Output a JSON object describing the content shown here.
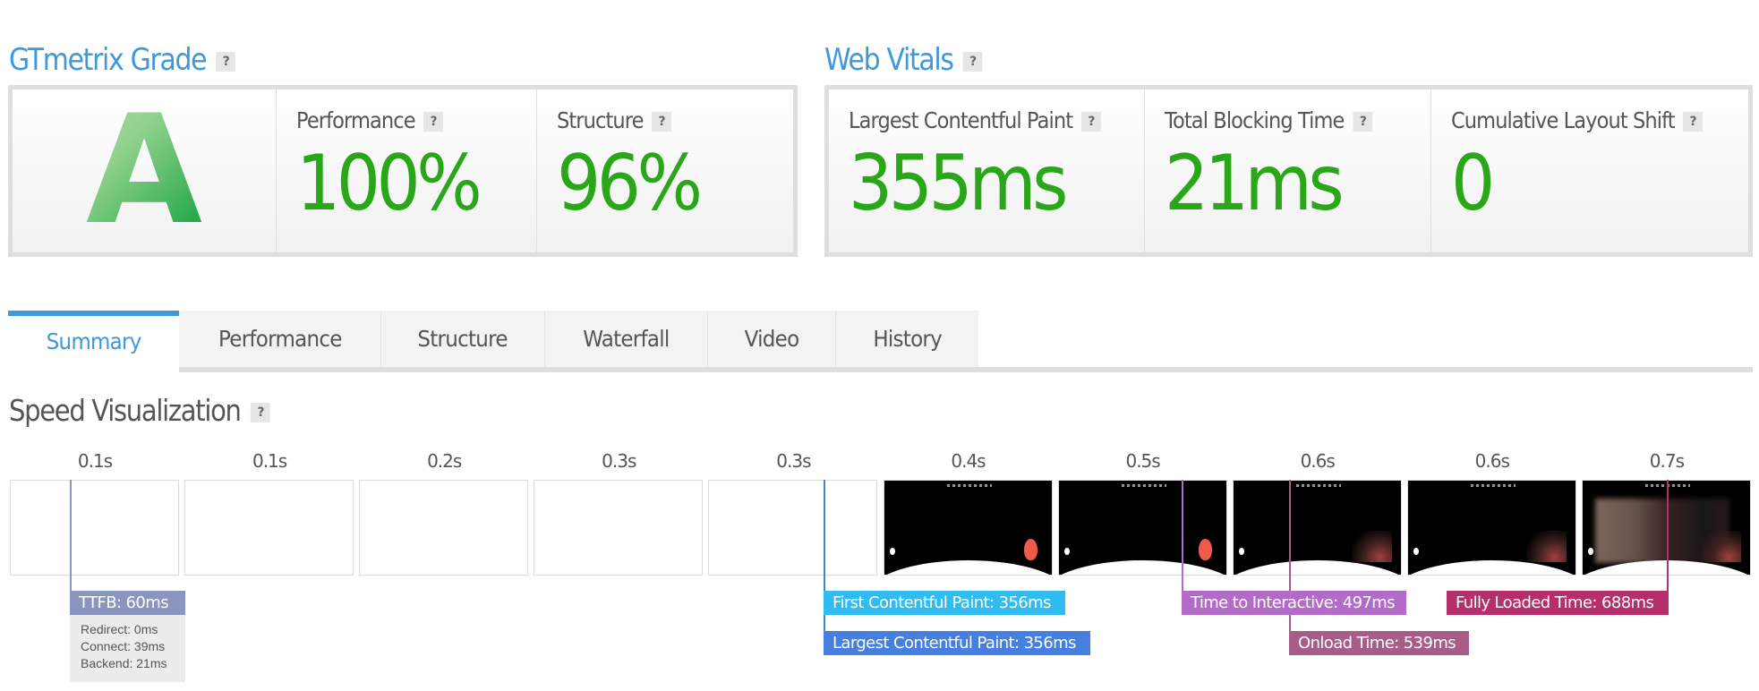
{
  "grade_section": {
    "title": "GTmetrix Grade",
    "help": "?",
    "grade": "A",
    "metrics": [
      {
        "label": "Performance",
        "help": "?",
        "value": "100%"
      },
      {
        "label": "Structure",
        "help": "?",
        "value": "96%"
      }
    ]
  },
  "web_vitals": {
    "title": "Web Vitals",
    "help": "?",
    "metrics": [
      {
        "label": "Largest Contentful Paint",
        "help": "?",
        "value": "355ms"
      },
      {
        "label": "Total Blocking Time",
        "help": "?",
        "value": "21ms"
      },
      {
        "label": "Cumulative Layout Shift",
        "help": "?",
        "value": "0"
      }
    ]
  },
  "tabs": [
    {
      "label": "Summary",
      "active": true
    },
    {
      "label": "Performance",
      "active": false
    },
    {
      "label": "Structure",
      "active": false
    },
    {
      "label": "Waterfall",
      "active": false
    },
    {
      "label": "Video",
      "active": false
    },
    {
      "label": "History",
      "active": false
    }
  ],
  "speed_visualization": {
    "title": "Speed Visualization",
    "help": "?",
    "frames": [
      {
        "time": "0.1s",
        "content": "blank"
      },
      {
        "time": "0.1s",
        "content": "blank"
      },
      {
        "time": "0.2s",
        "content": "blank"
      },
      {
        "time": "0.3s",
        "content": "blank"
      },
      {
        "time": "0.3s",
        "content": "blank"
      },
      {
        "time": "0.4s",
        "content": "page"
      },
      {
        "time": "0.5s",
        "content": "page"
      },
      {
        "time": "0.6s",
        "content": "page-loading"
      },
      {
        "time": "0.6s",
        "content": "page-loading"
      },
      {
        "time": "0.7s",
        "content": "page-full"
      }
    ],
    "markers": {
      "ttfb": {
        "label": "TTFB: 60ms",
        "color": "#8a96c0",
        "details": [
          "Redirect: 0ms",
          "Connect: 39ms",
          "Backend: 21ms"
        ]
      },
      "fcp": {
        "label": "First Contentful Paint: 356ms",
        "color": "#30bcf0"
      },
      "lcp": {
        "label": "Largest Contentful Paint: 356ms",
        "color": "#457fe0"
      },
      "tti": {
        "label": "Time to Interactive: 497ms",
        "color": "#b26cc7"
      },
      "onload": {
        "label": "Onload Time: 539ms",
        "color": "#a85c88"
      },
      "fully_loaded": {
        "label": "Fully Loaded Time: 688ms",
        "color": "#b5306a"
      }
    }
  },
  "colors": {
    "accent": "#3e98dc",
    "good_value": "#29a719",
    "border": "#dedede"
  }
}
